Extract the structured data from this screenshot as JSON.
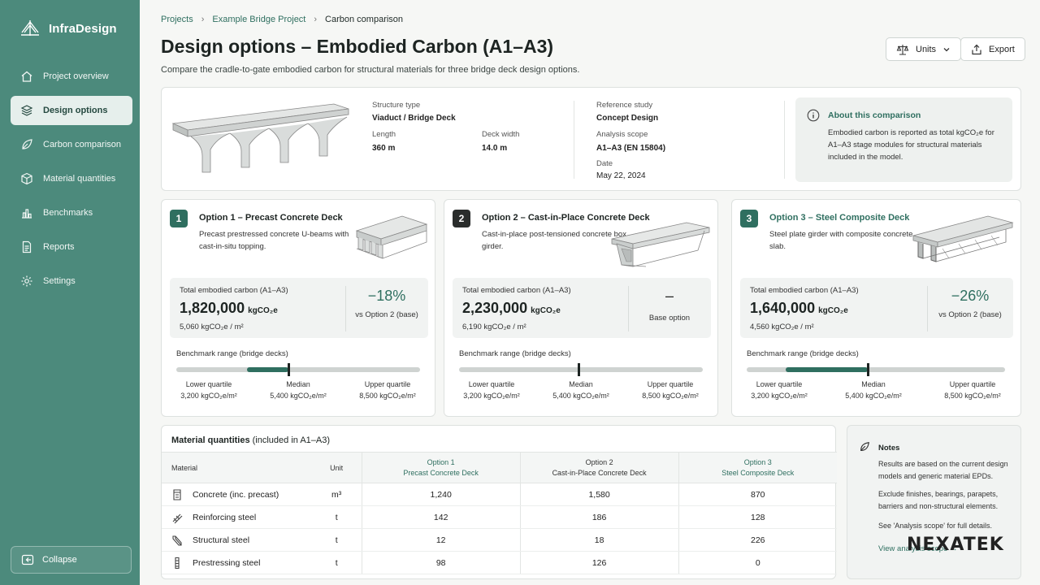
{
  "app": {
    "name": "InfraDesign"
  },
  "sidebar": {
    "items": [
      {
        "label": "Project overview",
        "icon": "home-icon"
      },
      {
        "label": "Design options",
        "icon": "layers-icon",
        "active": true
      },
      {
        "label": "Carbon comparison",
        "icon": "leaf-icon"
      },
      {
        "label": "Material quantities",
        "icon": "cube-icon"
      },
      {
        "label": "Benchmarks",
        "icon": "bar-chart-icon"
      },
      {
        "label": "Reports",
        "icon": "document-icon"
      },
      {
        "label": "Settings",
        "icon": "gear-icon"
      }
    ],
    "collapse_label": "Collapse"
  },
  "breadcrumb": {
    "items": [
      "Projects",
      "Example Bridge Project",
      "Carbon comparison"
    ]
  },
  "header": {
    "title": "Design options – Embodied Carbon (A1–A3)",
    "subtitle": "Compare the cradle-to-gate embodied carbon for structural materials for three bridge deck design options.",
    "units_label": "Units",
    "export_label": "Export"
  },
  "summary": {
    "structure_type_label": "Structure type",
    "structure_type": "Viaduct / Bridge Deck",
    "length_label": "Length",
    "length": "360 m",
    "deck_width_label": "Deck width",
    "deck_width": "14.0 m",
    "reference_study_label": "Reference study",
    "reference_study": "Concept Design",
    "analysis_scope_label": "Analysis scope",
    "analysis_scope": "A1–A3 (EN 15804)",
    "date_label": "Date",
    "date": "May 22, 2024",
    "about_title": "About this comparison",
    "about_body": "Embodied carbon is reported as total kgCO₂e for A1–A3 stage modules for structural materials included in the model."
  },
  "options": [
    {
      "num": "1",
      "title": "Option 1 – Precast Concrete Deck",
      "desc": "Precast prestressed concrete U-beams with cast-in-situ topping.",
      "total_label": "Total embodied carbon (A1–A3)",
      "total": "1,820,000",
      "unit": "kgCO₂e",
      "per_area": "5,060 kgCO₂e / m²",
      "delta": "−18%",
      "vs": "vs Option 2 (base)",
      "bench_label": "Benchmark range (bridge decks)",
      "marker": 0.46,
      "fill_start": 0.29,
      "lower_label": "Lower quartile",
      "lower": "3,200 kgCO₂e/m²",
      "median_label": "Median",
      "median": "5,400 kgCO₂e/m²",
      "upper_label": "Upper quartile",
      "upper": "8,500 kgCO₂e/m²"
    },
    {
      "num": "2",
      "title": "Option 2 – Cast-in-Place Concrete Deck",
      "desc": "Cast-in-place post-tensioned concrete box girder.",
      "total_label": "Total embodied carbon (A1–A3)",
      "total": "2,230,000",
      "unit": "kgCO₂e",
      "per_area": "6,190 kgCO₂e / m²",
      "delta": "–",
      "vs": "Base option",
      "bench_label": "Benchmark range (bridge decks)",
      "marker": 0.49,
      "fill_start": 0.49,
      "lower_label": "Lower quartile",
      "lower": "3,200 kgCO₂e/m²",
      "median_label": "Median",
      "median": "5,400 kgCO₂e/m²",
      "upper_label": "Upper quartile",
      "upper": "8,500 kgCO₂e/m²"
    },
    {
      "num": "3",
      "title": "Option 3 – Steel Composite Deck",
      "desc": "Steel plate girder with composite concrete slab.",
      "total_label": "Total embodied carbon (A1–A3)",
      "total": "1,640,000",
      "unit": "kgCO₂e",
      "per_area": "4,560 kgCO₂e / m²",
      "delta": "−26%",
      "vs": "vs Option 2 (base)",
      "bench_label": "Benchmark range (bridge decks)",
      "marker": 0.47,
      "fill_start": 0.15,
      "lower_label": "Lower quartile",
      "lower": "3,200 kgCO₂e/m²",
      "median_label": "Median",
      "median": "5,400 kgCO₂e/m²",
      "upper_label": "Upper quartile",
      "upper": "8,500 kgCO₂e/m²"
    }
  ],
  "materials": {
    "title": "Material quantities",
    "title_suffix": "(included in A1–A3)",
    "headers": {
      "material": "Material",
      "unit": "Unit",
      "opt1": "Option 1",
      "opt1_sub": "Precast Concrete Deck",
      "opt2": "Option 2",
      "opt2_sub": "Cast-in-Place Concrete Deck",
      "opt3": "Option 3",
      "opt3_sub": "Steel Composite Deck"
    },
    "rows": [
      {
        "name": "Concrete (inc. precast)",
        "unit": "m³",
        "o1": "1,240",
        "o2": "1,580",
        "o3": "870",
        "icon": "concrete-icon"
      },
      {
        "name": "Reinforcing steel",
        "unit": "t",
        "o1": "142",
        "o2": "186",
        "o3": "128",
        "icon": "rebar-icon"
      },
      {
        "name": "Structural steel",
        "unit": "t",
        "o1": "12",
        "o2": "18",
        "o3": "226",
        "icon": "beam-icon"
      },
      {
        "name": "Prestressing steel",
        "unit": "t",
        "o1": "98",
        "o2": "126",
        "o3": "0",
        "icon": "strand-icon"
      }
    ]
  },
  "notes": {
    "title": "Notes",
    "p1": "Results are based on the current design models and generic material EPDs.",
    "p2": "Exclude finishes, bearings, parapets, barriers and non-structural elements.",
    "p3": "See 'Analysis scope' for full details.",
    "link": "View analysis scope →"
  },
  "watermark": "NEXATEK",
  "colors": {
    "sidebar": "#4c8a7c",
    "accent": "#2f6f60",
    "dark_badge": "#2a2d2c"
  }
}
